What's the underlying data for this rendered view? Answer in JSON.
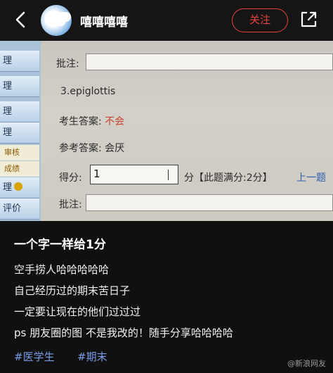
{
  "header": {
    "back_icon": "chevron-left-icon",
    "username": "嘻嘻嘻嘻",
    "follow_label": "关注",
    "share_icon": "share-icon",
    "accent_color": "#e8433f"
  },
  "photo": {
    "sidebar_items": [
      "理",
      "理",
      "理",
      "理"
    ],
    "sidebar_sub": [
      "审核",
      "成绩"
    ],
    "sidebar_bottom": [
      "理",
      "评价"
    ],
    "comment_label": "批注:",
    "question": "3.epiglottis",
    "student_answer_label": "考生答案:",
    "student_answer": "不会",
    "reference_answer_label": "参考答案:",
    "reference_answer": "会厌",
    "score_label": "得分:",
    "score_value": "1",
    "score_note": "分【此题满分:2分】",
    "prev_link": "上一题",
    "comment_label_2": "批注:"
  },
  "post": {
    "title": "一个字一样给1分",
    "lines": [
      "空手捞人哈哈哈哈哈",
      "自己经历过的期末苦日子",
      "一定要让现在的他们过过过",
      "ps 朋友圈的图 不是我改的！随手分享哈哈哈哈"
    ],
    "tags": [
      "#医学生",
      "#期末"
    ],
    "watermark": "@新浪网友"
  }
}
